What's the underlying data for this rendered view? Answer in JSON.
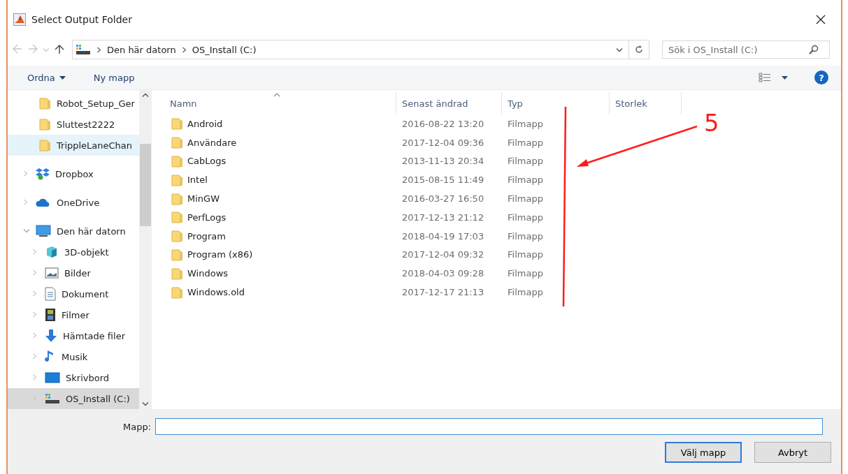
{
  "window": {
    "title": "Select Output Folder"
  },
  "address": {
    "back_disabled": true,
    "forward_disabled": true,
    "crumbs": [
      "Den här datorn",
      "OS_Install (C:)"
    ]
  },
  "search": {
    "placeholder": "Sök i OS_Install (C:)"
  },
  "toolbar": {
    "organize": "Ordna",
    "new_folder": "Ny mapp",
    "help": "?"
  },
  "nav_top": [
    {
      "label": "Robot_Setup_Ger",
      "kind": "folder",
      "selected": false,
      "hovered": false
    },
    {
      "label": "Sluttest2222",
      "kind": "folder",
      "selected": false,
      "hovered": false
    },
    {
      "label": "TrippleLaneChan",
      "kind": "folder",
      "selected": false,
      "hovered": true
    }
  ],
  "nav": [
    {
      "label": "Dropbox",
      "kind": "dropbox",
      "selected": false,
      "hovered": false,
      "expanded": false
    },
    {
      "label": "OneDrive",
      "kind": "onedrive",
      "selected": false,
      "hovered": false,
      "expanded": false
    },
    {
      "label": "Den här datorn",
      "kind": "pc",
      "selected": false,
      "hovered": false,
      "expanded": true,
      "children": [
        {
          "label": "3D-objekt",
          "kind": "cube",
          "selected": false,
          "hovered": false,
          "expanded": false
        },
        {
          "label": "Bilder",
          "kind": "pictures",
          "selected": false,
          "hovered": false,
          "expanded": false
        },
        {
          "label": "Dokument",
          "kind": "documents",
          "selected": false,
          "hovered": false,
          "expanded": false
        },
        {
          "label": "Filmer",
          "kind": "videos",
          "selected": false,
          "hovered": false,
          "expanded": false
        },
        {
          "label": "Hämtade filer",
          "kind": "downloads",
          "selected": false,
          "hovered": false,
          "expanded": false
        },
        {
          "label": "Musik",
          "kind": "music",
          "selected": false,
          "hovered": false,
          "expanded": false
        },
        {
          "label": "Skrivbord",
          "kind": "desktop",
          "selected": false,
          "hovered": false,
          "expanded": false
        },
        {
          "label": "OS_Install (C:)",
          "kind": "drive",
          "selected": true,
          "hovered": false,
          "expanded": false
        }
      ]
    }
  ],
  "table": {
    "columns": [
      "Namn",
      "Senast ändrad",
      "Typ",
      "Storlek"
    ],
    "rows": [
      {
        "name": "Android",
        "modified": "2016-08-22 13:20",
        "type": "Filmapp"
      },
      {
        "name": "Användare",
        "modified": "2017-12-04 09:36",
        "type": "Filmapp"
      },
      {
        "name": "CabLogs",
        "modified": "2013-11-13 20:34",
        "type": "Filmapp"
      },
      {
        "name": "Intel",
        "modified": "2015-08-15 11:49",
        "type": "Filmapp"
      },
      {
        "name": "MinGW",
        "modified": "2016-03-27 16:50",
        "type": "Filmapp"
      },
      {
        "name": "PerfLogs",
        "modified": "2017-12-13 21:12",
        "type": "Filmapp"
      },
      {
        "name": "Program",
        "modified": "2018-04-19 17:03",
        "type": "Filmapp"
      },
      {
        "name": "Program (x86)",
        "modified": "2017-12-04 09:32",
        "type": "Filmapp"
      },
      {
        "name": "Windows",
        "modified": "2018-04-03 09:28",
        "type": "Filmapp"
      },
      {
        "name": "Windows.old",
        "modified": "2017-12-17 21:13",
        "type": "Filmapp"
      }
    ]
  },
  "annotation": {
    "label": "5"
  },
  "folder_field": {
    "label": "Mapp:"
  },
  "buttons": [
    "Välj mapp",
    "Avbryt"
  ]
}
